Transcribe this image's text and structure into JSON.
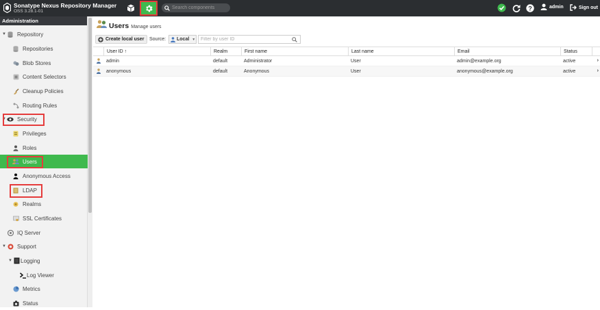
{
  "header": {
    "app_title": "Sonatype Nexus Repository Manager",
    "version": "OSS 3.28.1-01",
    "search_placeholder": "Search components",
    "username": "admin",
    "sign_out": "Sign out"
  },
  "sidebar": {
    "section_title": "Administration",
    "items": [
      {
        "label": "Repository",
        "icon": "database-icon"
      },
      {
        "label": "Repositories",
        "icon": "database-icon"
      },
      {
        "label": "Blob Stores",
        "icon": "blob-stores-icon"
      },
      {
        "label": "Content Selectors",
        "icon": "selectors-icon"
      },
      {
        "label": "Cleanup Policies",
        "icon": "broom-icon"
      },
      {
        "label": "Routing Rules",
        "icon": "routing-icon"
      },
      {
        "label": "Security",
        "icon": "eye-icon"
      },
      {
        "label": "Privileges",
        "icon": "badge-icon"
      },
      {
        "label": "Roles",
        "icon": "role-user-icon"
      },
      {
        "label": "Users",
        "icon": "users-icon"
      },
      {
        "label": "Anonymous Access",
        "icon": "anonymous-icon"
      },
      {
        "label": "LDAP",
        "icon": "ldap-book-icon"
      },
      {
        "label": "Realms",
        "icon": "realms-icon"
      },
      {
        "label": "SSL Certificates",
        "icon": "certificate-icon"
      },
      {
        "label": "IQ Server",
        "icon": "iq-server-icon"
      },
      {
        "label": "Support",
        "icon": "support-icon"
      },
      {
        "label": "Logging",
        "icon": "logging-icon"
      },
      {
        "label": "Log Viewer",
        "icon": "terminal-icon"
      },
      {
        "label": "Metrics",
        "icon": "metrics-icon"
      },
      {
        "label": "Status",
        "icon": "status-icon"
      }
    ]
  },
  "page": {
    "title": "Users",
    "subtitle": "Manage users",
    "create_button": "Create local user",
    "source_label": "Source:",
    "source_value": "Local",
    "filter_placeholder": "Filter by user ID"
  },
  "table": {
    "columns": [
      "User ID ↑",
      "Realm",
      "First name",
      "Last name",
      "Email",
      "Status"
    ],
    "rows": [
      {
        "user_id": "admin",
        "realm": "default",
        "first_name": "Administrator",
        "last_name": "User",
        "email": "admin@example.org",
        "status": "active"
      },
      {
        "user_id": "anonymous",
        "realm": "default",
        "first_name": "Anonymous",
        "last_name": "User",
        "email": "anonymous@example.org",
        "status": "active"
      }
    ]
  },
  "colors": {
    "topbar": "#2b2e31",
    "accent_green": "#3fb94e",
    "highlight_red": "#e53b3b"
  }
}
